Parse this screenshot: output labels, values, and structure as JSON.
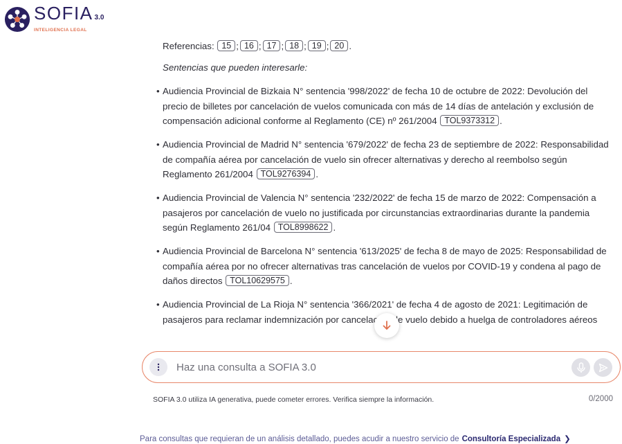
{
  "brand": {
    "name": "SOFIA",
    "version": "3.0",
    "tagline": "INTELIGENCIA LEGAL",
    "colors": {
      "primary": "#2a2060",
      "accent": "#e0714f"
    }
  },
  "answer": {
    "references_label": "Referencias:",
    "references": [
      "15",
      "16",
      "17",
      "18",
      "19",
      "20"
    ],
    "subtitle": "Sentencias que pueden interesarle:",
    "results": [
      {
        "text": "Audiencia Provincial de Bizkaia N° sentencia '998/2022' de fecha 10 de octubre de 2022: Devolución del precio de billetes por cancelación de vuelos comunicada con más de 14 días de antelación y exclusión de compensación adicional conforme al Reglamento (CE) nº 261/2004",
        "tol": "TOL9373312"
      },
      {
        "text": "Audiencia Provincial de Madrid N° sentencia '679/2022' de fecha 23 de septiembre de 2022: Responsabilidad de compañía aérea por cancelación de vuelo sin ofrecer alternativas y derecho al reembolso según Reglamento 261/2004",
        "tol": "TOL9276394"
      },
      {
        "text": "Audiencia Provincial de Valencia N° sentencia '232/2022' de fecha 15 de marzo de 2022: Compensación a pasajeros por cancelación de vuelo no justificada por circunstancias extraordinarias durante la pandemia según Reglamento 261/04",
        "tol": "TOL8998622"
      },
      {
        "text": "Audiencia Provincial de Barcelona N° sentencia '613/2025' de fecha 8 de mayo de 2025: Responsabilidad de compañía aérea por no ofrecer alternativas tras cancelación de vuelos por COVID-19 y condena al pago de daños directos",
        "tol": "TOL10629575"
      },
      {
        "text": "Audiencia Provincial de La Rioja N° sentencia '366/2021' de fecha 4 de agosto de 2021: Legitimación de pasajeros para reclamar indemnización por cancelación de vuelo debido a huelga de controladores aéreos",
        "tol": ""
      }
    ]
  },
  "composer": {
    "placeholder": "Haz una consulta a SOFIA 3.0",
    "value": "",
    "disclaimer": "SOFIA 3.0 utiliza IA generativa, puede cometer errores. Verifica siempre la información.",
    "char_count": "0/2000"
  },
  "footer": {
    "text": "Para consultas que requieran de un análisis detallado, puedes acudir a nuestro servicio de",
    "link_label": "Consultoría Especializada"
  },
  "icons": {
    "logo": "sofia-logo-icon",
    "scroll_down": "arrow-down-icon",
    "menu": "vertical-dots-icon",
    "mic": "microphone-icon",
    "send": "send-icon",
    "footer_chevron": "chevron-right-icon"
  }
}
